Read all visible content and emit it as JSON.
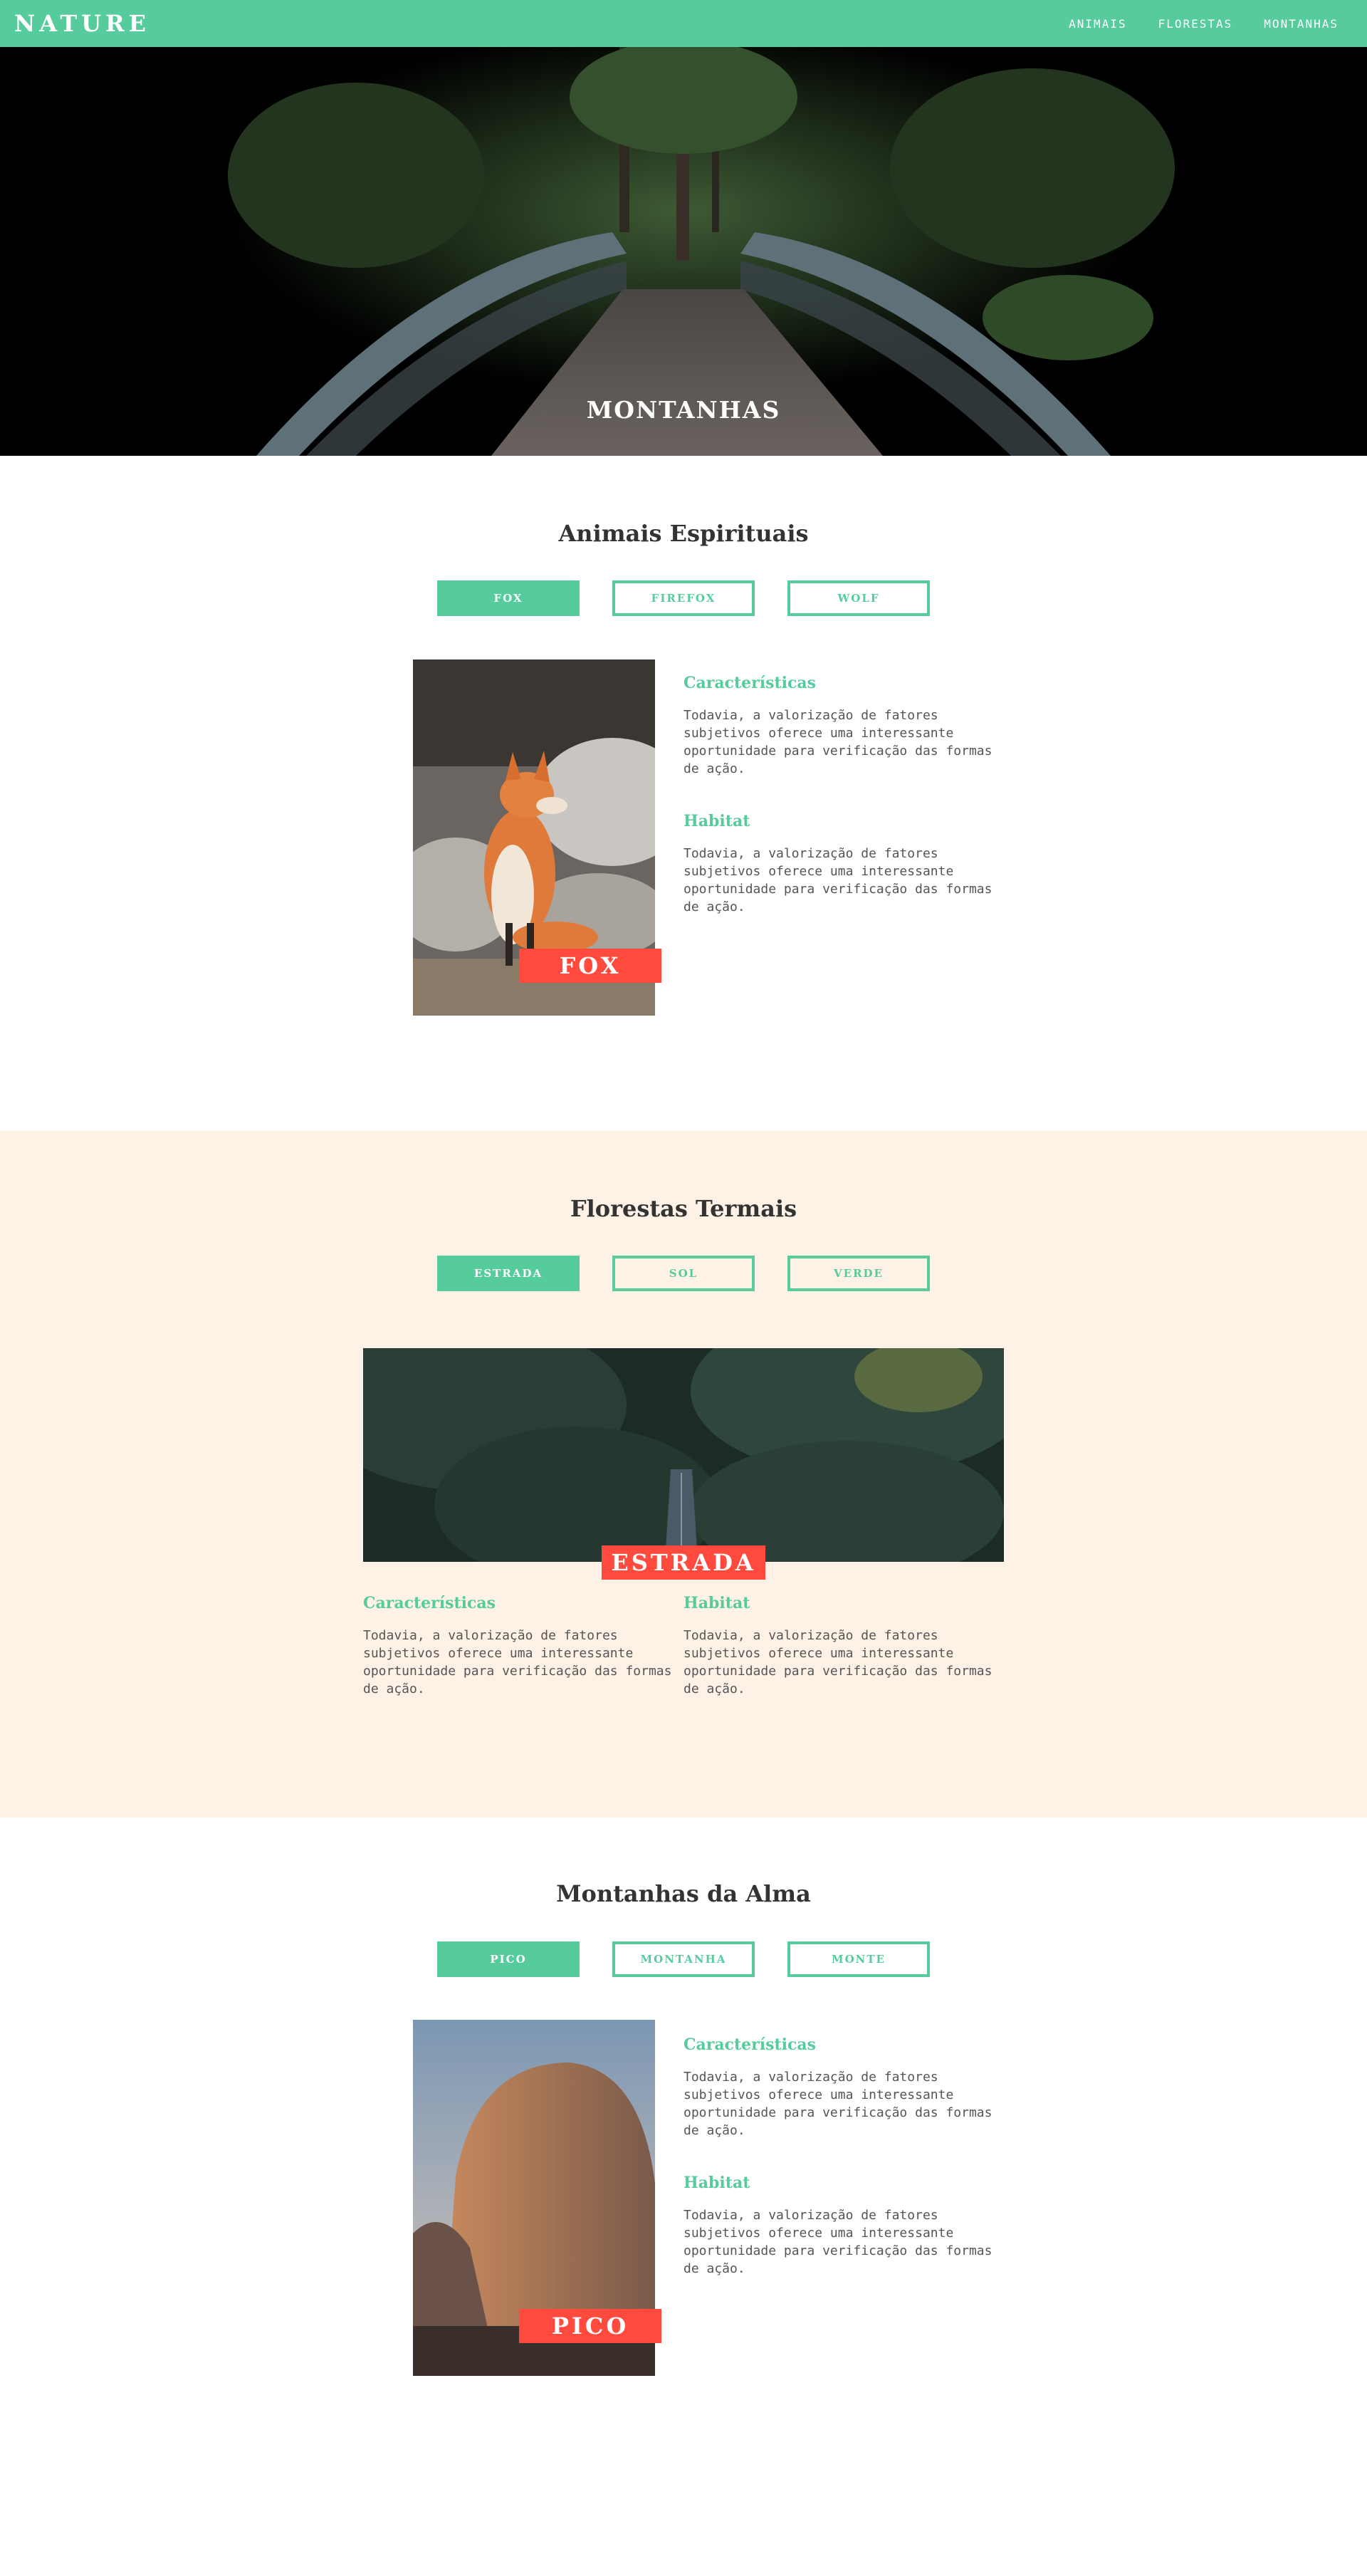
{
  "header": {
    "logo": "NATURE",
    "nav": [
      "ANIMAIS",
      "FLORESTAS",
      "MONTANHAS"
    ]
  },
  "hero": {
    "title": "MONTANHAS"
  },
  "animais": {
    "title": "Animais Espirituais",
    "tabs": [
      "FOX",
      "FIREFOX",
      "WOLF"
    ],
    "active_tab": "FOX",
    "badge": "FOX",
    "info": [
      {
        "heading": "Características",
        "text": "Todavia, a valorização de fatores subjetivos oferece uma interessante oportunidade para verificação das formas de ação."
      },
      {
        "heading": "Habitat",
        "text": "Todavia, a valorização de fatores subjetivos oferece uma interessante oportunidade para verificação das formas de ação."
      }
    ]
  },
  "florestas": {
    "title": "Florestas Termais",
    "tabs": [
      "ESTRADA",
      "SOL",
      "VERDE"
    ],
    "active_tab": "ESTRADA",
    "badge": "ESTRADA",
    "info": [
      {
        "heading": "Características",
        "text": "Todavia, a valorização de fatores subjetivos oferece uma interessante oportunidade para verificação das formas de ação."
      },
      {
        "heading": "Habitat",
        "text": "Todavia, a valorização de fatores subjetivos oferece uma interessante oportunidade para verificação das formas de ação."
      }
    ]
  },
  "montanhas": {
    "title": "Montanhas da Alma",
    "tabs": [
      "PICO",
      "MONTANHA",
      "MONTE"
    ],
    "active_tab": "PICO",
    "badge": "PICO",
    "info": [
      {
        "heading": "Características",
        "text": "Todavia, a valorização de fatores subjetivos oferece uma interessante oportunidade para verificação das formas de ação."
      },
      {
        "heading": "Habitat",
        "text": "Todavia, a valorização de fatores subjetivos oferece uma interessante oportunidade para verificação das formas de ação."
      }
    ]
  },
  "colors": {
    "accent": "#56cc9d",
    "badge": "#ff4a3d",
    "section_alt_bg": "#fef1e6",
    "title": "#333333"
  }
}
